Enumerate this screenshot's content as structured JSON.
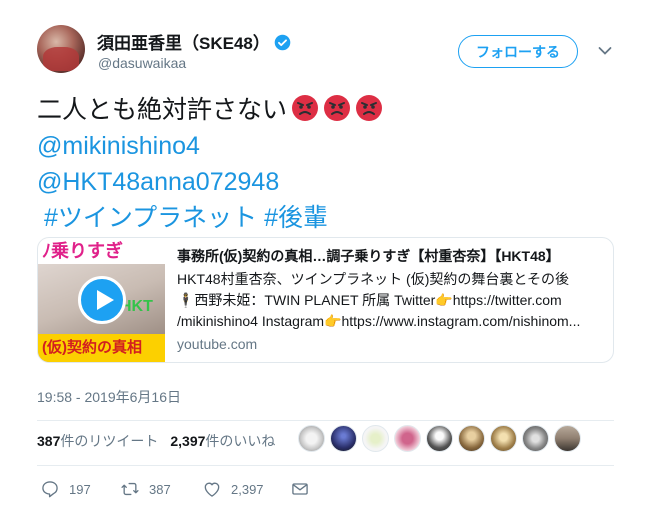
{
  "user": {
    "display_name": "須田亜香里（SKE48）",
    "handle": "@dasuwaikaa"
  },
  "follow_button": {
    "label": "フォローする"
  },
  "tweet": {
    "text_line1": "二人とも絶対許さない",
    "mention1": "@mikinishino4",
    "mention2": "@HKT48anna072948",
    "hashtag1": "#ツインプラネット",
    "hashtag2": "#後輩"
  },
  "card": {
    "title": "事務所(仮)契約の真相…調子乗りすぎ【村重杏奈】【HKT48】",
    "desc_line1": "HKT48村重杏奈、ツインプラネット (仮)契約の舞台裏とその後",
    "desc_line2": "🕴西野未姫：TWIN PLANET 所属 Twitter👉https://twitter.com",
    "desc_line3": "/mikinishino4 Instagram👉https://www.instagram.com/nishinom...",
    "domain": "youtube.com",
    "thumb_banner": "ﾉ乗りすぎ",
    "thumb_bottom": "(仮)契約の真相",
    "thumb_hkt": "HKT"
  },
  "timestamp": "19:58 - 2019年6月16日",
  "stats": {
    "retweets_count": "387",
    "retweets_label": "件のリツイート",
    "likes_count": "2,397",
    "likes_label": "件のいいね"
  },
  "actions": {
    "reply_count": "197",
    "retweet_count": "387",
    "like_count": "2,397"
  },
  "colors": {
    "accent": "#1da1f2",
    "link": "#1b95e0",
    "muted": "#657786"
  }
}
